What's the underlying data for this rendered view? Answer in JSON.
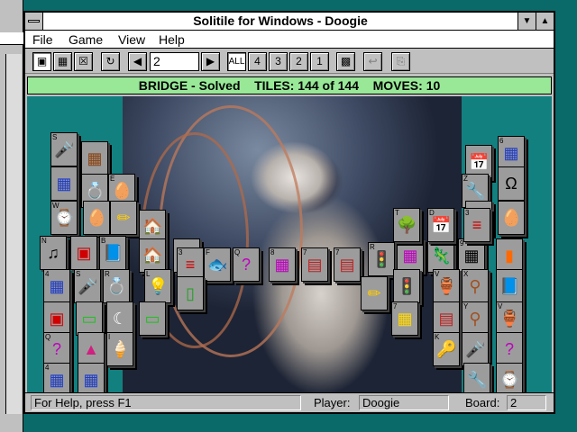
{
  "window": {
    "title": "Solitile for Windows - Doogie"
  },
  "menu": {
    "file": "File",
    "game": "Game",
    "view": "View",
    "help": "Help"
  },
  "toolbar": {
    "level_value": "2",
    "all_label": "ALL",
    "n4": "4",
    "n3": "3",
    "n2": "2",
    "n1": "1"
  },
  "game_status": {
    "layout": "BRIDGE - Solved",
    "tiles": "TILES: 144 of 144",
    "moves": "MOVES: 10"
  },
  "statusbar": {
    "help": "For Help, press F1",
    "player_label": "Player:",
    "player_value": "Doogie",
    "board_label": "Board:",
    "board_value": "2"
  },
  "tiles": [
    {
      "id": "t1",
      "icon": "🎤",
      "corner": "S",
      "color": "#1e90ff"
    },
    {
      "id": "t2",
      "icon": "▦",
      "corner": "",
      "color": "#8b4513"
    },
    {
      "id": "t3",
      "icon": "▦",
      "corner": "",
      "color": "#1e3cc8"
    },
    {
      "id": "t4",
      "icon": "💍",
      "corner": "",
      "color": "#d4a017"
    },
    {
      "id": "t5",
      "icon": "🥚",
      "corner": "E",
      "color": "#ffffff"
    },
    {
      "id": "t6",
      "icon": "⌚",
      "corner": "W",
      "color": "#ffd700"
    },
    {
      "id": "t7",
      "icon": "🥚",
      "corner": "",
      "color": "#ffffff"
    },
    {
      "id": "t8",
      "icon": "✏",
      "corner": "",
      "color": "#ffcc00"
    },
    {
      "id": "t9",
      "icon": "🏠",
      "corner": "",
      "color": "#4060c0"
    },
    {
      "id": "t10",
      "icon": "♫",
      "corner": "N",
      "color": "#000000"
    },
    {
      "id": "t11",
      "icon": "▣",
      "corner": "",
      "color": "#d00000"
    },
    {
      "id": "t12",
      "icon": "📘",
      "corner": "B",
      "color": "#2040c0"
    },
    {
      "id": "t13",
      "icon": "🏠",
      "corner": "",
      "color": "#4060c0"
    },
    {
      "id": "t14",
      "icon": "▦",
      "corner": "",
      "color": "#1e3cc8"
    },
    {
      "id": "t15",
      "icon": "≡",
      "corner": "3",
      "color": "#d00000"
    },
    {
      "id": "t16",
      "icon": "🐟",
      "corner": "F",
      "color": "#ff8c00"
    },
    {
      "id": "t17",
      "icon": "?",
      "corner": "Q",
      "color": "#c000c0"
    },
    {
      "id": "t18",
      "icon": "▦",
      "corner": "8",
      "color": "#c000c0"
    },
    {
      "id": "t19",
      "icon": "▤",
      "corner": "7",
      "color": "#c02020"
    },
    {
      "id": "t20",
      "icon": "▤",
      "corner": "7",
      "color": "#c02020"
    },
    {
      "id": "t21",
      "icon": "🚦",
      "corner": "R",
      "color": "#20a020"
    },
    {
      "id": "t22",
      "icon": "▦",
      "corner": "",
      "color": "#c000c0"
    },
    {
      "id": "t23",
      "icon": "🦎",
      "corner": "G",
      "color": "#20a020"
    },
    {
      "id": "t24",
      "icon": "▦",
      "corner": "9",
      "color": "#000000"
    },
    {
      "id": "t25",
      "icon": "▮",
      "corner": "",
      "color": "#ff6a00"
    },
    {
      "id": "t26",
      "icon": "▦",
      "corner": "4",
      "color": "#1e3cc8"
    },
    {
      "id": "t27",
      "icon": "🎤",
      "corner": "S",
      "color": "#1e90ff"
    },
    {
      "id": "t28",
      "icon": "💍",
      "corner": "R",
      "color": "#d4a017"
    },
    {
      "id": "t29",
      "icon": "💡",
      "corner": "L",
      "color": "#ffff80"
    },
    {
      "id": "t30",
      "icon": "▯",
      "corner": "",
      "color": "#20a020"
    },
    {
      "id": "t31",
      "icon": "✏",
      "corner": "",
      "color": "#ffcc00"
    },
    {
      "id": "t32",
      "icon": "🚦",
      "corner": "",
      "color": "#20a020"
    },
    {
      "id": "t33",
      "icon": "🏺",
      "corner": "V",
      "color": "#e07020"
    },
    {
      "id": "t34",
      "icon": "⚲",
      "corner": "X",
      "color": "#a05020"
    },
    {
      "id": "t35",
      "icon": "📘",
      "corner": "",
      "color": "#2040c0"
    },
    {
      "id": "t36",
      "icon": "▣",
      "corner": "",
      "color": "#d00000"
    },
    {
      "id": "t37",
      "icon": "▭",
      "corner": "",
      "color": "#20c020"
    },
    {
      "id": "t38",
      "icon": "☾",
      "corner": "",
      "color": "#ffffff"
    },
    {
      "id": "t39",
      "icon": "▭",
      "corner": "",
      "color": "#20c020"
    },
    {
      "id": "t40",
      "icon": "▦",
      "corner": "7",
      "color": "#ffd700"
    },
    {
      "id": "t41",
      "icon": "▤",
      "corner": "",
      "color": "#c02020"
    },
    {
      "id": "t42",
      "icon": "⚲",
      "corner": "Y",
      "color": "#a05020"
    },
    {
      "id": "t43",
      "icon": "🏺",
      "corner": "V",
      "color": "#e07020"
    },
    {
      "id": "t44",
      "icon": "?",
      "corner": "Q",
      "color": "#c000c0"
    },
    {
      "id": "t45",
      "icon": "▲",
      "corner": "",
      "color": "#d02080"
    },
    {
      "id": "t46",
      "icon": "🍦",
      "corner": "I",
      "color": "#ffffff"
    },
    {
      "id": "t47",
      "icon": "🔑",
      "corner": "K",
      "color": "#d4a017"
    },
    {
      "id": "t48",
      "icon": "🎤",
      "corner": "",
      "color": "#1e90ff"
    },
    {
      "id": "t49",
      "icon": "?",
      "corner": "",
      "color": "#c000c0"
    },
    {
      "id": "t50",
      "icon": "▦",
      "corner": "4",
      "color": "#1e3cc8"
    },
    {
      "id": "t51",
      "icon": "▦",
      "corner": "",
      "color": "#1e3cc8"
    },
    {
      "id": "t52",
      "icon": "🔧",
      "corner": "",
      "color": "#a05020"
    },
    {
      "id": "t53",
      "icon": "⌚",
      "corner": "",
      "color": "#ffd700"
    },
    {
      "id": "t54",
      "icon": "▦",
      "corner": "6",
      "color": "#1e3cc8"
    },
    {
      "id": "t55",
      "icon": "📅",
      "corner": "",
      "color": "#ff8c00"
    },
    {
      "id": "t56",
      "icon": "Ω",
      "corner": "",
      "color": "#000000"
    },
    {
      "id": "t57",
      "icon": "🔧",
      "corner": "Z",
      "color": "#a05020"
    },
    {
      "id": "t58",
      "icon": "▦",
      "corner": "",
      "color": "#1e3cc8"
    },
    {
      "id": "t59",
      "icon": "🌳",
      "corner": "T",
      "color": "#20a020"
    },
    {
      "id": "t60",
      "icon": "📅",
      "corner": "D",
      "color": "#ff8c00"
    },
    {
      "id": "t61",
      "icon": "≡",
      "corner": "3",
      "color": "#d00000"
    },
    {
      "id": "t62",
      "icon": "🥚",
      "corner": "",
      "color": "#ffffff"
    }
  ]
}
